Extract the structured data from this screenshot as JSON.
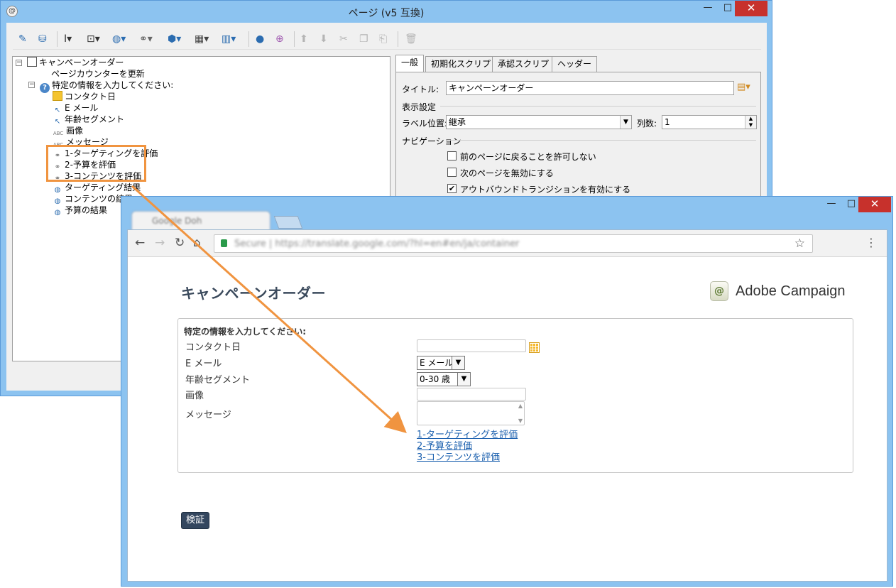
{
  "editor": {
    "window_title": "ページ (v5 互換)",
    "minimize": "—",
    "maximize": "□",
    "close": "✕",
    "tree": {
      "root": "キャンペーンオーダー",
      "items": [
        "ページカウンターを更新",
        "特定の情報を入力してください:",
        "コンタクト日",
        "E メール",
        "年齢セグメント",
        "画像",
        "メッセージ",
        "1-ターゲティングを評価",
        "2-予算を評価",
        "3-コンテンツを評価",
        "ターゲティング結果",
        "コンテンツの結果",
        "予算の結果"
      ]
    },
    "tabs": [
      "一般",
      "初期化スクリプト",
      "承認スクリプト",
      "ヘッダー"
    ],
    "title_label": "タイトル:",
    "title_value": "キャンペーンオーダー",
    "display_settings": "表示設定",
    "label_position_label": "ラベル位置:",
    "label_position_value": "継承",
    "columns_label": "列数:",
    "columns_value": "1",
    "navigation": "ナビゲーション",
    "nav_options": [
      {
        "label": "前のページに戻ることを許可しない",
        "checked": false
      },
      {
        "label": "次のページを無効にする",
        "checked": false
      },
      {
        "label": "アウトバウンドトランジションを有効にする",
        "checked": true
      }
    ]
  },
  "browser": {
    "tab_title": "Google Doh",
    "url": "Secure | https://translate.google.com/?hl=en#en/ja/container",
    "minimize": "—",
    "maximize": "□",
    "close": "✕"
  },
  "form": {
    "page_title": "キャンペーンオーダー",
    "brand": "Adobe Campaign",
    "question": "特定の情報を入力してください:",
    "fields": {
      "contact_date": "コンタクト日",
      "email": "E メール",
      "email_value": "E メール",
      "age_segment": "年齢セグメント",
      "age_value": "0-30 歳",
      "image": "画像",
      "message": "メッセージ"
    },
    "links": [
      "1-ターゲティングを評価",
      "2-予算を評価",
      "3-コンテンツを評価"
    ],
    "submit": "検証"
  },
  "colors": {
    "accent_arrow": "#f09440",
    "window_frame": "#8cc3f0",
    "close_button": "#c7312c",
    "link": "#1a5fae",
    "submit_button": "#34475f"
  }
}
